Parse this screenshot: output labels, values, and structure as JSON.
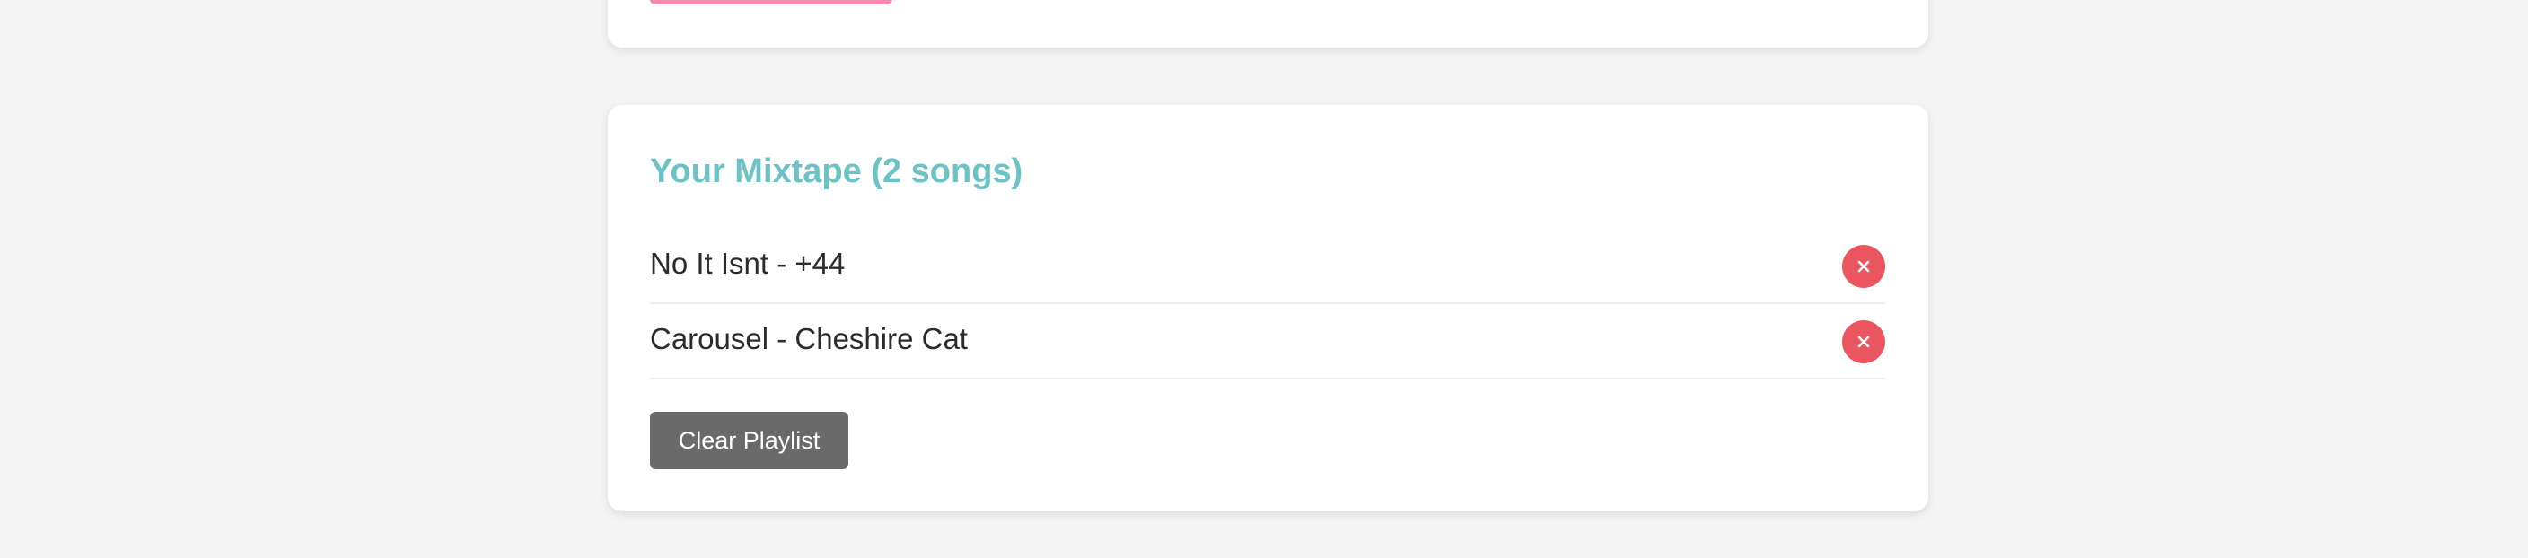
{
  "mixtape": {
    "title": "Your Mixtape (2 songs)",
    "songs": [
      {
        "label": "No It Isnt - +44",
        "remove_icon": "close-icon"
      },
      {
        "label": "Carousel - Cheshire Cat",
        "remove_icon": "close-icon"
      }
    ],
    "clear_label": "Clear Playlist"
  },
  "colors": {
    "page_background": "#f4f4f4",
    "card_background": "#ffffff",
    "title": "#6cc3c6",
    "top_accent": "#f28ab2",
    "remove_button": "#ea5560",
    "clear_button": "#6a6a6a"
  }
}
